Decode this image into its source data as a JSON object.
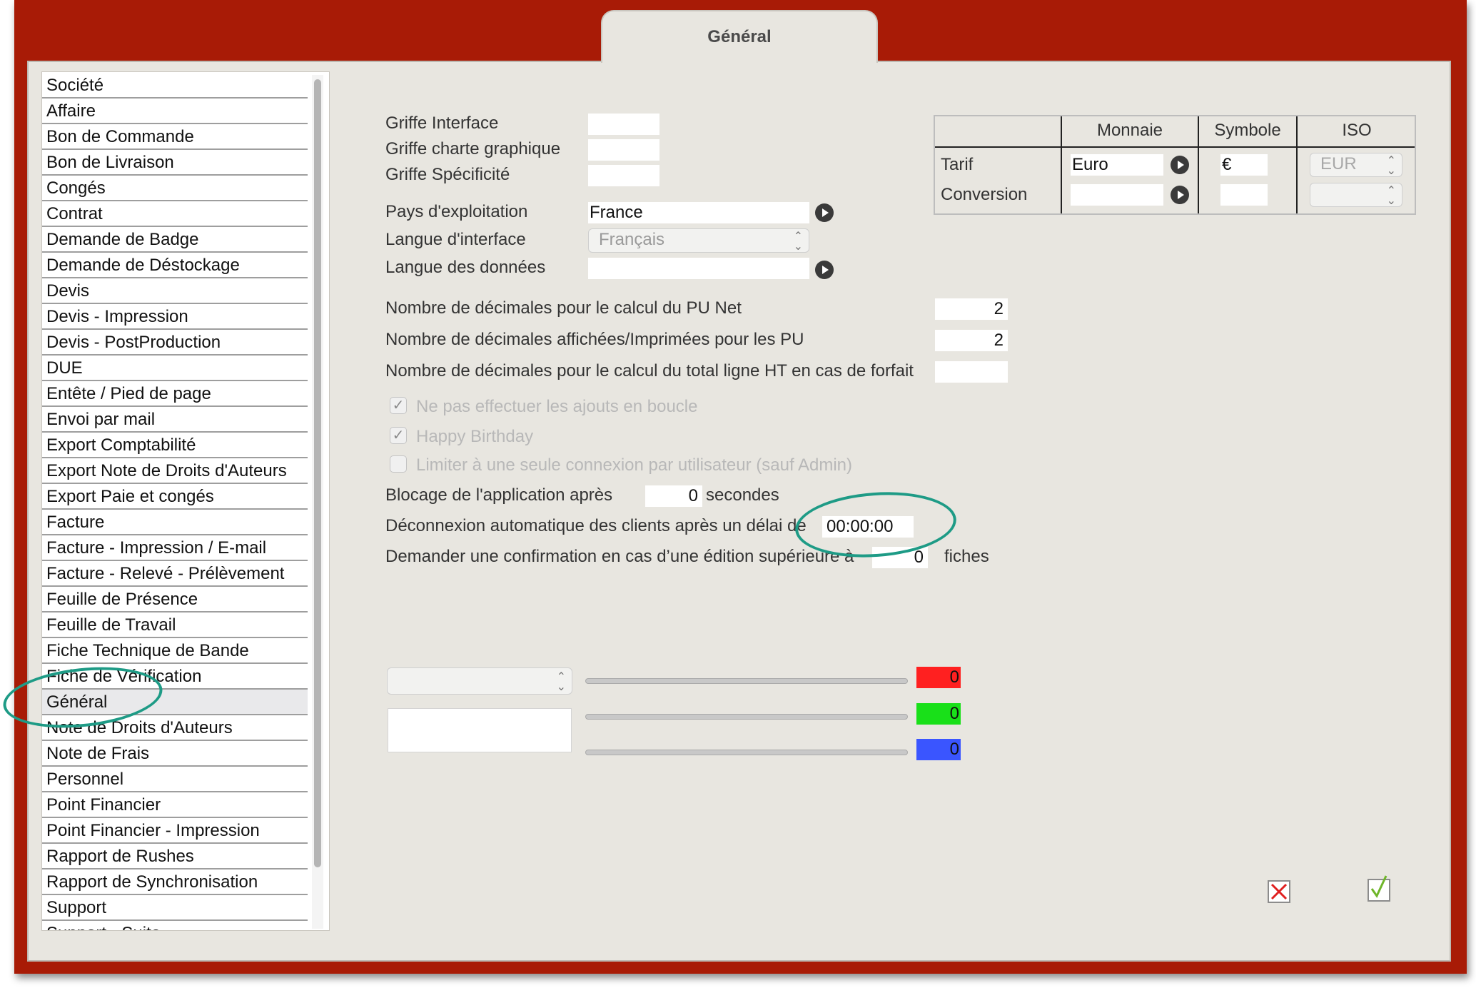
{
  "tab": {
    "title": "Général"
  },
  "sidebar": {
    "items": [
      "Société",
      "Affaire",
      "Bon de Commande",
      "Bon de Livraison",
      "Congés",
      "Contrat",
      "Demande de Badge",
      "Demande de Déstockage",
      "Devis",
      "Devis - Impression",
      "Devis - PostProduction",
      "DUE",
      "Entête / Pied de page",
      "Envoi par mail",
      "Export Comptabilité",
      "Export Note de Droits d'Auteurs",
      "Export Paie et congés",
      "Facture",
      "Facture - Impression / E-mail",
      "Facture - Relevé - Prélèvement",
      "Feuille de Présence",
      "Feuille de Travail",
      "Fiche Technique de Bande",
      "Fiche de Vérification",
      "Général",
      "Note de Droits d'Auteurs",
      "Note de Frais",
      "Personnel",
      "Point Financier",
      "Point Financier - Impression",
      "Rapport de Rushes",
      "Rapport de Synchronisation",
      "Support",
      "Support - Suite"
    ],
    "selected": "Général"
  },
  "form": {
    "griffe_interface": "Griffe Interface",
    "griffe_charte": "Griffe charte graphique",
    "griffe_specificite": "Griffe Spécificité",
    "pays_label": "Pays d'exploitation",
    "pays_value": "France",
    "langue_interface_label": "Langue d'interface",
    "langue_interface_value": "Français",
    "langue_donnees_label": "Langue des données",
    "langue_donnees_value": "",
    "dec_pu_net_label": "Nombre de décimales pour le calcul du PU Net",
    "dec_pu_net_value": "2",
    "dec_pu_aff_label": "Nombre de décimales affichées/Imprimées pour les PU",
    "dec_pu_aff_value": "2",
    "dec_forfait_label": "Nombre de décimales pour le calcul du total ligne HT en cas de forfait",
    "dec_forfait_value": "",
    "chk_boucle": "Ne pas effectuer les ajouts en boucle",
    "chk_birthday": "Happy Birthday",
    "chk_connexion": "Limiter à une seule connexion par utilisateur (sauf Admin)",
    "blocage_label": "Blocage de l'application après",
    "blocage_value": "0",
    "blocage_unit": "secondes",
    "deconnexion_label": "Déconnexion automatique des clients après un délai de",
    "deconnexion_value": "00:00:00",
    "confirmation_label": "Demander une confirmation en cas d’une édition supérieure à",
    "confirmation_value": "0",
    "confirmation_unit": "fiches"
  },
  "currency": {
    "headers": [
      "Monnaie",
      "Symbole",
      "ISO"
    ],
    "rows": [
      {
        "label": "Tarif",
        "monnaie": "Euro",
        "symbole": "€",
        "iso": "EUR"
      },
      {
        "label": "Conversion",
        "monnaie": "",
        "symbole": "",
        "iso": ""
      }
    ]
  },
  "color": {
    "red": {
      "value": "0",
      "hex": "#ff2020"
    },
    "green": {
      "value": "0",
      "hex": "#19e019"
    },
    "blue": {
      "value": "0",
      "hex": "#3a55ff"
    }
  },
  "accent": {
    "frame": "#a81b06",
    "highlight_ring": "#1e9b86"
  }
}
